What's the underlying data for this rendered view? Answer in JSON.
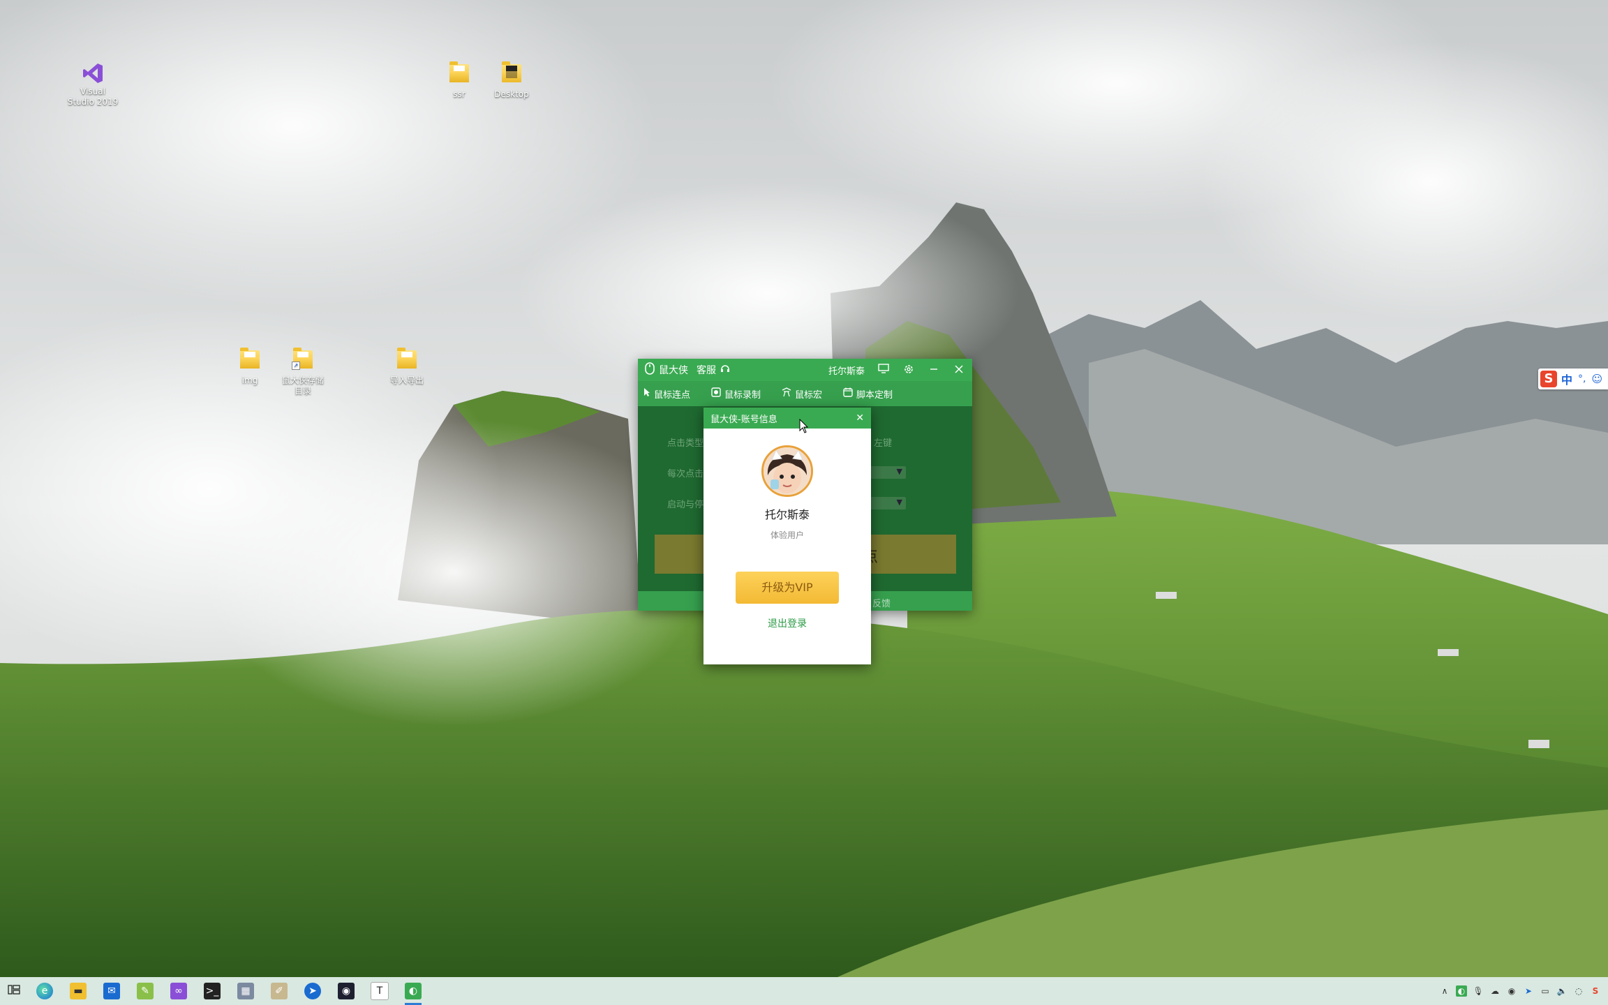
{
  "desktop": {
    "icons": [
      {
        "label": "Visual\nStudio 2019"
      },
      {
        "label": "ssr"
      },
      {
        "label": "Desktop"
      },
      {
        "label": "img"
      },
      {
        "label": "鼠大侠存储\n目录"
      },
      {
        "label": "导入导出"
      }
    ]
  },
  "ime": {
    "logo": "S",
    "mode": "中",
    "punct": "°,",
    "emoji": "☺"
  },
  "app": {
    "title": "鼠大侠",
    "service": "客服",
    "username": "托尔斯泰",
    "tabs": [
      {
        "label": "鼠标连点",
        "icon": "cursor-icon"
      },
      {
        "label": "鼠标录制",
        "icon": "record-icon"
      },
      {
        "label": "鼠标宏",
        "icon": "macro-icon"
      },
      {
        "label": "脚本定制",
        "icon": "script-icon"
      }
    ],
    "body": {
      "label1": "点击类型",
      "label1_right": "左键",
      "label2": "每次点击",
      "label3": "启动与停",
      "start_button": "点"
    },
    "footer": {
      "feedback": "反馈"
    }
  },
  "dialog": {
    "title": "鼠大侠-账号信息",
    "close": "✕",
    "username": "托尔斯泰",
    "user_type": "体验用户",
    "vip_button": "升级为VIP",
    "logout": "退出登录"
  },
  "colors": {
    "app_green": "#3aaa52",
    "vip_gold": "#f3b934",
    "link_green": "#2a9a44"
  }
}
